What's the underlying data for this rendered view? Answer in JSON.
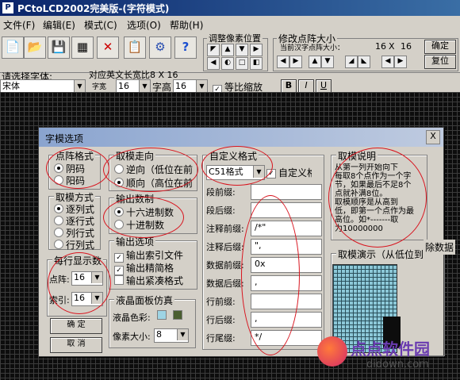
{
  "window": {
    "title": "PCtoLCD2002完美版-(字符模式)"
  },
  "menu": [
    "文件(F)",
    "编辑(E)",
    "模式(C)",
    "选项(O)",
    "帮助(H)"
  ],
  "toolbar": {
    "pixel_group_label": "调整像素位置",
    "dot_size_label": "修改点阵大小",
    "dot_size_hint": "当前汉字点阵大小：",
    "dot_w": "16",
    "dot_x": "X",
    "dot_h": "16",
    "confirm_btn": "确定",
    "restore_btn": "复位",
    "font_select_label": "请选择字体:",
    "font_value": "宋体",
    "ascii_size_label": "对应英文长宽比8 X 16",
    "char_width_label": "字宽",
    "char_width_value": "16",
    "char_height_label": "字高",
    "char_height_value": "16",
    "equal_ratio_label": "等比缩放",
    "bold_btn": "B",
    "italic_btn": "I",
    "underline_btn": "U"
  },
  "dialog": {
    "title": "字模选项",
    "close": "X",
    "dot_format": {
      "legend": "点阵格式",
      "options": [
        "阴码",
        "阳码"
      ],
      "selected": 0
    },
    "mode": {
      "legend": "取模方式",
      "options": [
        "逐列式",
        "逐行式",
        "列行式",
        "行列式"
      ],
      "selected": 0
    },
    "direction": {
      "legend": "取模走向",
      "options": [
        "逆向（低位在前",
        "顺向（高位在前"
      ],
      "selected": 1
    },
    "radix": {
      "legend": "输出数制",
      "options": [
        "十六进制数",
        "十进制数"
      ],
      "selected": 0
    },
    "output": {
      "legend": "输出选项",
      "items": [
        "输出索引文件",
        "输出精简格",
        "输出紧凑格式"
      ],
      "checked": [
        true,
        true,
        false
      ]
    },
    "per_line": {
      "legend": "每行显示数",
      "dot_label": "点阵:",
      "dot_value": "16",
      "index_label": "索引:",
      "index_value": "16"
    },
    "lcd": {
      "legend": "液晶面板仿真",
      "color_label": "液晶色彩:",
      "pixel_label": "像素大小:",
      "pixel_value": "8"
    },
    "custom": {
      "legend": "自定义格式",
      "format_value": "C51格式",
      "custom_check_label": "自定义格式",
      "rows": [
        {
          "label": "段前缀:",
          "value": ""
        },
        {
          "label": "段后缀:",
          "value": ""
        },
        {
          "label": "注释前缀:",
          "value": "/*\""
        },
        {
          "label": "注释后缀:",
          "value": "\","
        },
        {
          "label": "数据前缀:",
          "value": "0x"
        },
        {
          "label": "数据后缀:",
          "value": ","
        },
        {
          "label": "行前缀:",
          "value": ""
        },
        {
          "label": "行后缀:",
          "value": ","
        },
        {
          "label": "行尾缀:",
          "value": "*/"
        }
      ]
    },
    "help": {
      "legend": "取模说明",
      "lines": [
        "从第一列开始向下",
        "每取8个点作为一个字",
        "节，如果最后不足8个",
        "点就补满8位。",
        "取模顺序是从高到",
        "低，即第一个点作为最",
        "高位。如*-------取",
        "为10000000"
      ]
    },
    "demo_legend": "取模演示（从低位到",
    "ok_btn": "确  定",
    "cancel_btn": "取  消",
    "side_label": "除数据"
  },
  "watermark": {
    "brand": "点点软件园",
    "url": "didown.com"
  },
  "colors": {
    "lcd_color": "#9ed4e4",
    "lcd_color2": "#4a5e30",
    "annotation": "#d8141e"
  }
}
